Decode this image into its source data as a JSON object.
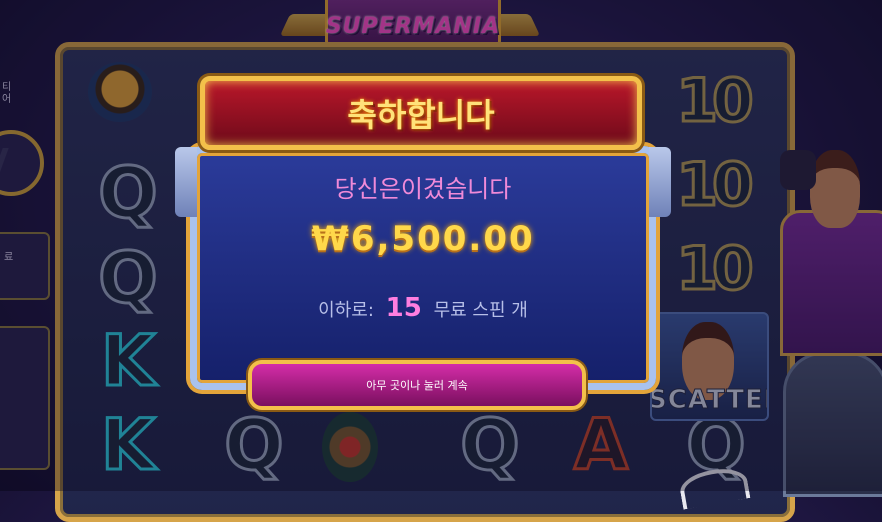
{
  "logo": {
    "text": "SUPERMANIA"
  },
  "side_panel": {
    "label_top": "티\n어",
    "label_mid": "료"
  },
  "reels": {
    "symbols": [
      "ring",
      "Q",
      "Q",
      "K",
      "K",
      "Q",
      "Q",
      "10",
      "10",
      "10",
      "gem",
      "Q",
      "A",
      "Q"
    ],
    "scatter_label": "SCATTER"
  },
  "popup": {
    "title": "축하합니다",
    "subtitle": "당신은이겼습니다",
    "amount": "₩6,500.00",
    "freespins_prefix": "이하로:",
    "freespins_count": "15",
    "freespins_suffix": "무료 스핀 개",
    "continue_label": "아무 곳이나 눌러 계속"
  },
  "colors": {
    "accent_gold": "#f3c04a",
    "header_red": "#b9172a",
    "panel_blue": "#2b3b9a",
    "amount_yellow": "#ffd84a",
    "button_magenta": "#d42da8"
  }
}
